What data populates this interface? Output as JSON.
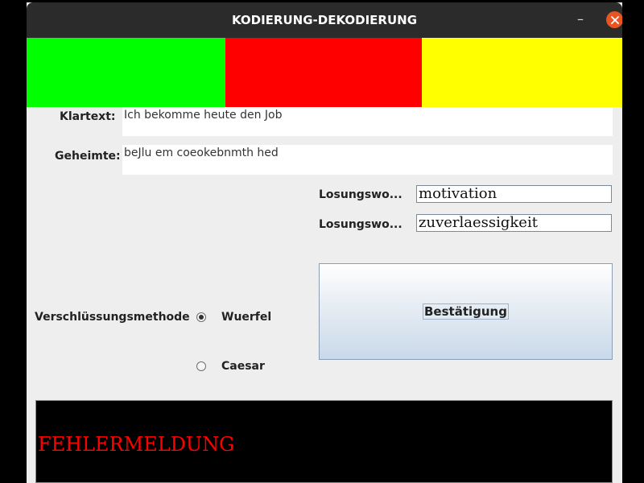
{
  "window": {
    "title": "KODIERUNG-DEKODIERUNG",
    "minimize_glyph": "–",
    "close_glyph": "✕"
  },
  "color_bands": [
    {
      "name": "green",
      "color": "#00ff00"
    },
    {
      "name": "red",
      "color": "#ff0000"
    },
    {
      "name": "yellow",
      "color": "#ffff00"
    }
  ],
  "plaintext": {
    "label": "Klartext:",
    "value": "Ich bekomme heute den Job"
  },
  "ciphertext": {
    "label": "Geheimte:",
    "value": "beJlu em coeokebnmth hed"
  },
  "keywords": [
    {
      "label": "Losungswo...",
      "value": "motivation"
    },
    {
      "label": "Losungswo...",
      "value": "zuverlaessigkeit"
    }
  ],
  "confirm_button": {
    "label": "Bestätigung"
  },
  "method": {
    "label": "Verschlüssungsmethode",
    "options": [
      {
        "label": "Wuerfel",
        "selected": true
      },
      {
        "label": "Caesar",
        "selected": false
      }
    ]
  },
  "message": {
    "text": "FEHLERMELDUNG",
    "color": "#ff0000"
  }
}
